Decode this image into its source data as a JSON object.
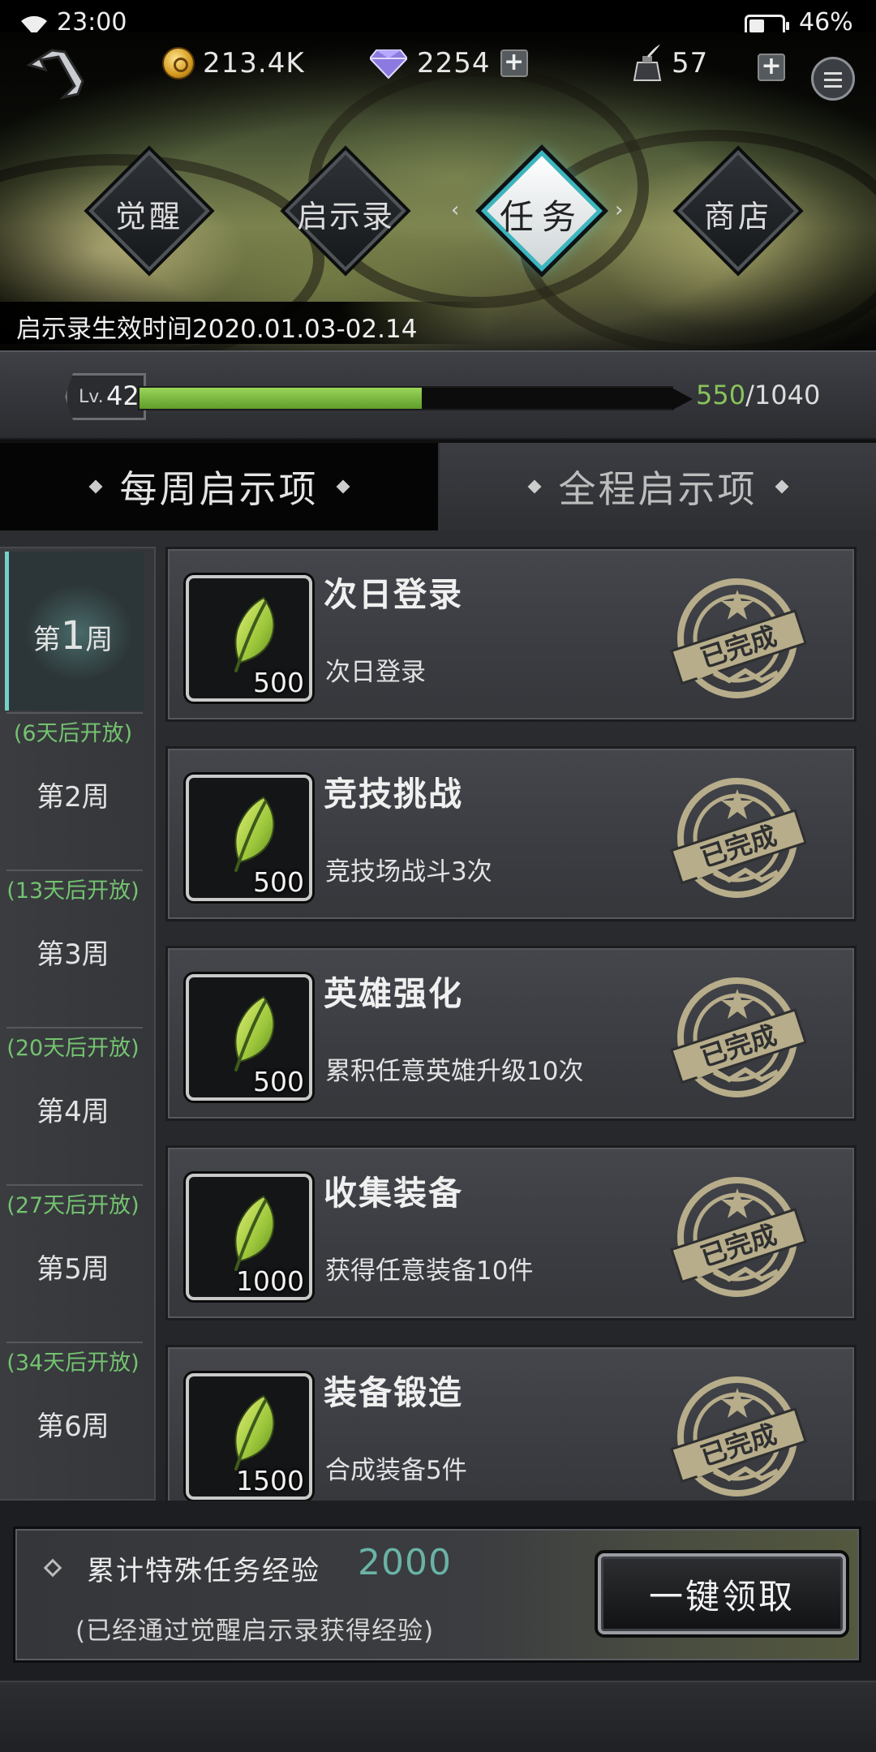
{
  "status_bar": {
    "time": "23:00",
    "battery": "46%"
  },
  "header": {
    "gold": "213.4K",
    "diamonds": "2254",
    "ink": "57",
    "plus_symbol": "+"
  },
  "nav": {
    "awaken": "觉醒",
    "revelation": "启示录",
    "tasks": "任务",
    "shop": "商店",
    "active": "tasks"
  },
  "validity": "启示录生效时间2020.01.03-02.14",
  "level": {
    "prefix": "Lv.",
    "value": "42",
    "xp_current": "550",
    "xp_max": "1040",
    "xp_separator": "/",
    "fraction": 0.53
  },
  "tabs": [
    {
      "label": "每周启示项",
      "active": true
    },
    {
      "label": "全程启示项",
      "active": false
    }
  ],
  "weeks": [
    {
      "name_prefix": "第",
      "name_num": "1",
      "name_suffix": "周",
      "open_text": "",
      "active": true
    },
    {
      "name": "第2周",
      "open_text": "(6天后开放)"
    },
    {
      "name": "第3周",
      "open_text": "(13天后开放)"
    },
    {
      "name": "第4周",
      "open_text": "(20天后开放)"
    },
    {
      "name": "第5周",
      "open_text": "(27天后开放)"
    },
    {
      "name": "第6周",
      "open_text": "(34天后开放)"
    }
  ],
  "tasks": [
    {
      "title": "次日登录",
      "desc": "次日登录",
      "reward": "500",
      "status": "已完成"
    },
    {
      "title": "竞技挑战",
      "desc": "竞技场战斗3次",
      "reward": "500",
      "status": "已完成"
    },
    {
      "title": "英雄强化",
      "desc": "累积任意英雄升级10次",
      "reward": "500",
      "status": "已完成"
    },
    {
      "title": "收集装备",
      "desc": "获得任意装备10件",
      "reward": "1000",
      "status": "已完成"
    },
    {
      "title": "装备锻造",
      "desc": "合成装备5件",
      "reward": "1500",
      "status": "已完成"
    }
  ],
  "footer": {
    "exp_label": "累计特殊任务经验",
    "exp_value": "2000",
    "exp_note": "(已经通过觉醒启示录获得经验)",
    "claim_button": "一键领取"
  },
  "colors": {
    "xp_fill": "#7bbd43",
    "open_text": "#74c370",
    "exp_value": "#6ab3a6",
    "active_nav_border": "#3bb6c0",
    "stamp": "#b7ad8a"
  },
  "icons": {
    "back": "back-arrow-icon",
    "gold": "gold-coin-icon",
    "diamond": "diamond-gem-icon",
    "ink": "ink-bottle-icon",
    "menu": "hamburger-menu-icon",
    "reward": "leaf-icon",
    "completed": "completed-stamp-icon"
  }
}
